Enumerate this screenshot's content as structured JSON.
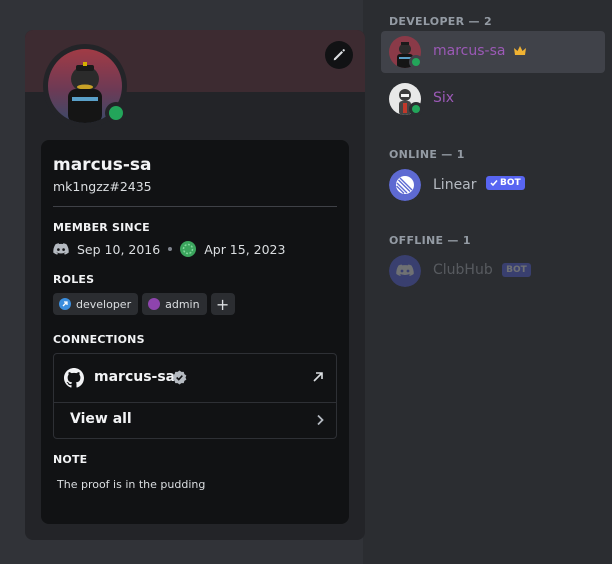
{
  "profile": {
    "username": "marcus-sa",
    "tag": "mk1ngzz#2435",
    "member_since_label": "MEMBER SINCE",
    "discord_date": "Sep 10, 2016",
    "server_date": "Apr 15, 2023",
    "roles_label": "ROLES",
    "roles": [
      {
        "name": "developer",
        "color": "#3b8ede"
      },
      {
        "name": "admin",
        "color": "#8e44ad"
      }
    ],
    "add_role_label": "+",
    "connections_label": "CONNECTIONS",
    "connection": {
      "service": "github-icon",
      "name": "marcus-sa"
    },
    "view_all_label": "View all",
    "note_label": "NOTE",
    "note_text": "The proof is in the pudding"
  },
  "member_list": {
    "groups": [
      {
        "header": "DEVELOPER — 2"
      },
      {
        "header": "ONLINE — 1"
      },
      {
        "header": "OFFLINE — 1"
      }
    ],
    "members": [
      {
        "name": "marcus-sa",
        "color": "#9b59b6",
        "crown": true
      },
      {
        "name": "Six",
        "color": "#9b59b6"
      },
      {
        "name": "Linear",
        "color": "#b5bac1",
        "bot_label": "BOT",
        "verified": true
      },
      {
        "name": "ClubHub",
        "color": "#b5bac1",
        "bot_label": "BOT"
      }
    ]
  },
  "colors": {
    "online": "#23a55a",
    "brand": "#5865f2",
    "crown": "#f0b232"
  }
}
